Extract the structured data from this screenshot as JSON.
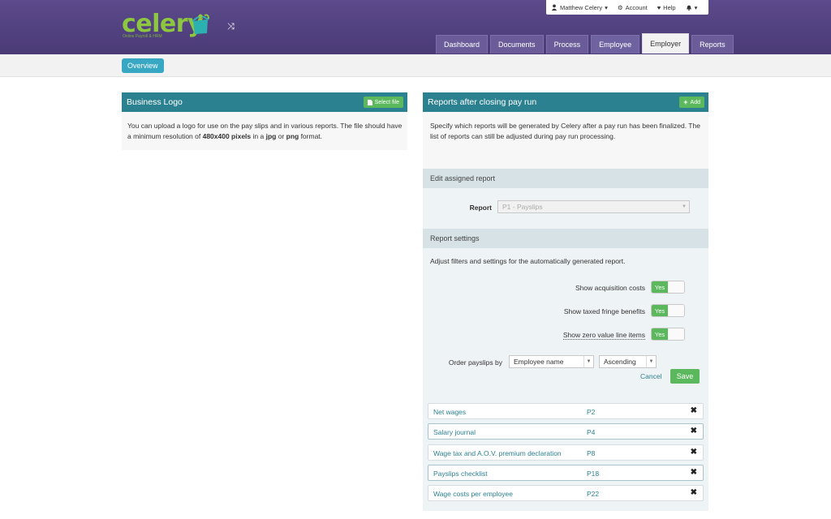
{
  "header": {
    "logo_text": "celery",
    "logo_subtitle": "Online Payroll & HRM",
    "user_menu": "Matthew Celery",
    "account": "Account",
    "help": "Help",
    "nav_tabs": [
      {
        "label": "Dashboard"
      },
      {
        "label": "Documents"
      },
      {
        "label": "Process"
      },
      {
        "label": "Employee"
      },
      {
        "label": "Employer"
      },
      {
        "label": "Reports"
      }
    ]
  },
  "subbar": {
    "overview": "Overview"
  },
  "business_logo": {
    "title": "Business Logo",
    "select_file": "Select file",
    "text_1": "You can upload a logo for use on the pay slips and in various reports. The file should have a minimum resolution of ",
    "resolution": "480x400 pixels",
    "text_2": " in a ",
    "format_1": "jpg",
    "text_3": " or ",
    "format_2": "png",
    "text_4": " format."
  },
  "reports_panel": {
    "title": "Reports after closing pay run",
    "add": "Add",
    "intro": "Specify which reports will be generated by Celery after a pay run has been finalized. The list of reports can still be adjusted during pay run processing.",
    "edit_section": "Edit assigned report",
    "report_label": "Report",
    "report_value": "P1 - Payslips",
    "settings_section": "Report settings",
    "settings_intro": "Adjust filters and settings for the automatically generated report.",
    "toggles": [
      {
        "label": "Show acquisition costs",
        "value": "Yes"
      },
      {
        "label": "Show taxed fringe benefits",
        "value": "Yes"
      },
      {
        "label": "Show zero value line items",
        "value": "Yes"
      }
    ],
    "order_label": "Order payslips by",
    "order_field": "Employee name",
    "order_direction": "Ascending",
    "cancel": "Cancel",
    "save": "Save",
    "reports": [
      {
        "name": "Net wages",
        "code": "P2"
      },
      {
        "name": "Salary journal",
        "code": "P4"
      },
      {
        "name": "Wage tax and A.O.V. premium declaration",
        "code": "P8"
      },
      {
        "name": "Payslips checklist",
        "code": "P18"
      },
      {
        "name": "Wage costs per employee",
        "code": "P22"
      }
    ]
  },
  "colors": {
    "header": "#4f3e7d",
    "teal": "#2c8191",
    "green": "#5cb85c",
    "logo_green": "#8dc63f"
  }
}
